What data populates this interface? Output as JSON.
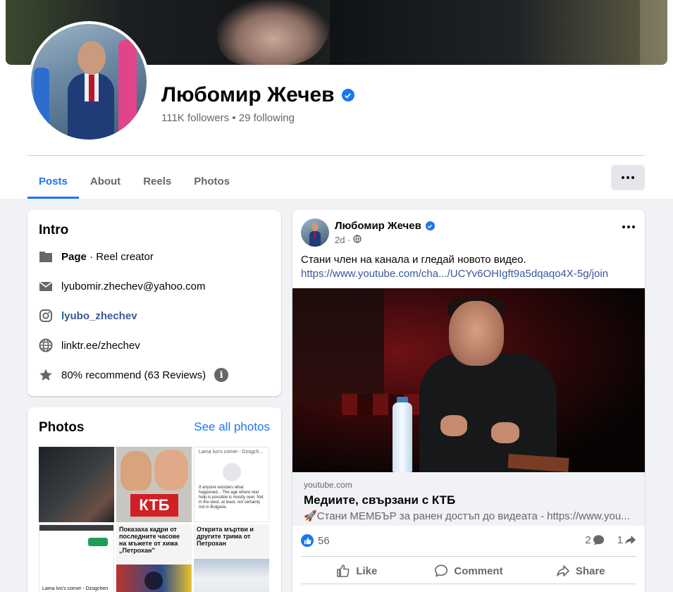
{
  "profile": {
    "name": "Любомир Жечев",
    "stats": "111K followers • 29 following"
  },
  "tabs": [
    {
      "label": "Posts",
      "active": true
    },
    {
      "label": "About"
    },
    {
      "label": "Reels"
    },
    {
      "label": "Photos"
    }
  ],
  "intro": {
    "title": "Intro",
    "page_label": "Page",
    "page_category": " · Reel creator",
    "email": "lyubomir.zhechev@yahoo.com",
    "instagram": "lyubo_zhechev",
    "website": "linktr.ee/zhechev",
    "recommend": "80% recommend (63 Reviews)",
    "info_glyph": "i"
  },
  "photos": {
    "title": "Photos",
    "see_all": "See all photos",
    "thumb_ktb": "КТБ",
    "thumb3_header": "Lama Ivo's corner - Dzogch...",
    "thumb3_text": "If anyone wonders what happened... The age where real help is possible is mostly over. Not in the west, at least, not certainly not in Bulgaria.",
    "thumb4_caption": "Lama Ivo's corner - Dzogchen and",
    "thumb5_headline": "Показаха кадри от последните часове на мъжете от хижа „Петрохан\"",
    "thumb6_headline": "Открита мъртви и другите трима от Петрохан"
  },
  "post": {
    "author": "Любомир Жечев",
    "time": "2d ·",
    "text": "Стани член на канала и гледай новото видео.",
    "link": "https://www.youtube.com/cha.../UCYv6OHIgft9a5dqaqo4X-5g/join",
    "preview": {
      "domain": "youtube.com",
      "title": "Медиите, свързани с КТБ",
      "description": "🚀Стани МЕМБЪР за ранен достъп до видеата - https://www.you..."
    },
    "likes": "56",
    "comments_count": "2",
    "shares_count": "1",
    "actions": {
      "like": "Like",
      "comment": "Comment",
      "share": "Share"
    }
  },
  "colors": {
    "accent": "#1877f2",
    "link": "#385898",
    "background": "#f0f2f5",
    "secondary_text": "#65676b"
  },
  "icons": [
    "verified-icon",
    "page-icon",
    "email-icon",
    "instagram-icon",
    "globe-icon",
    "star-icon",
    "info-icon",
    "globe-small-icon",
    "like-icon",
    "comment-icon",
    "share-icon",
    "more-icon"
  ]
}
